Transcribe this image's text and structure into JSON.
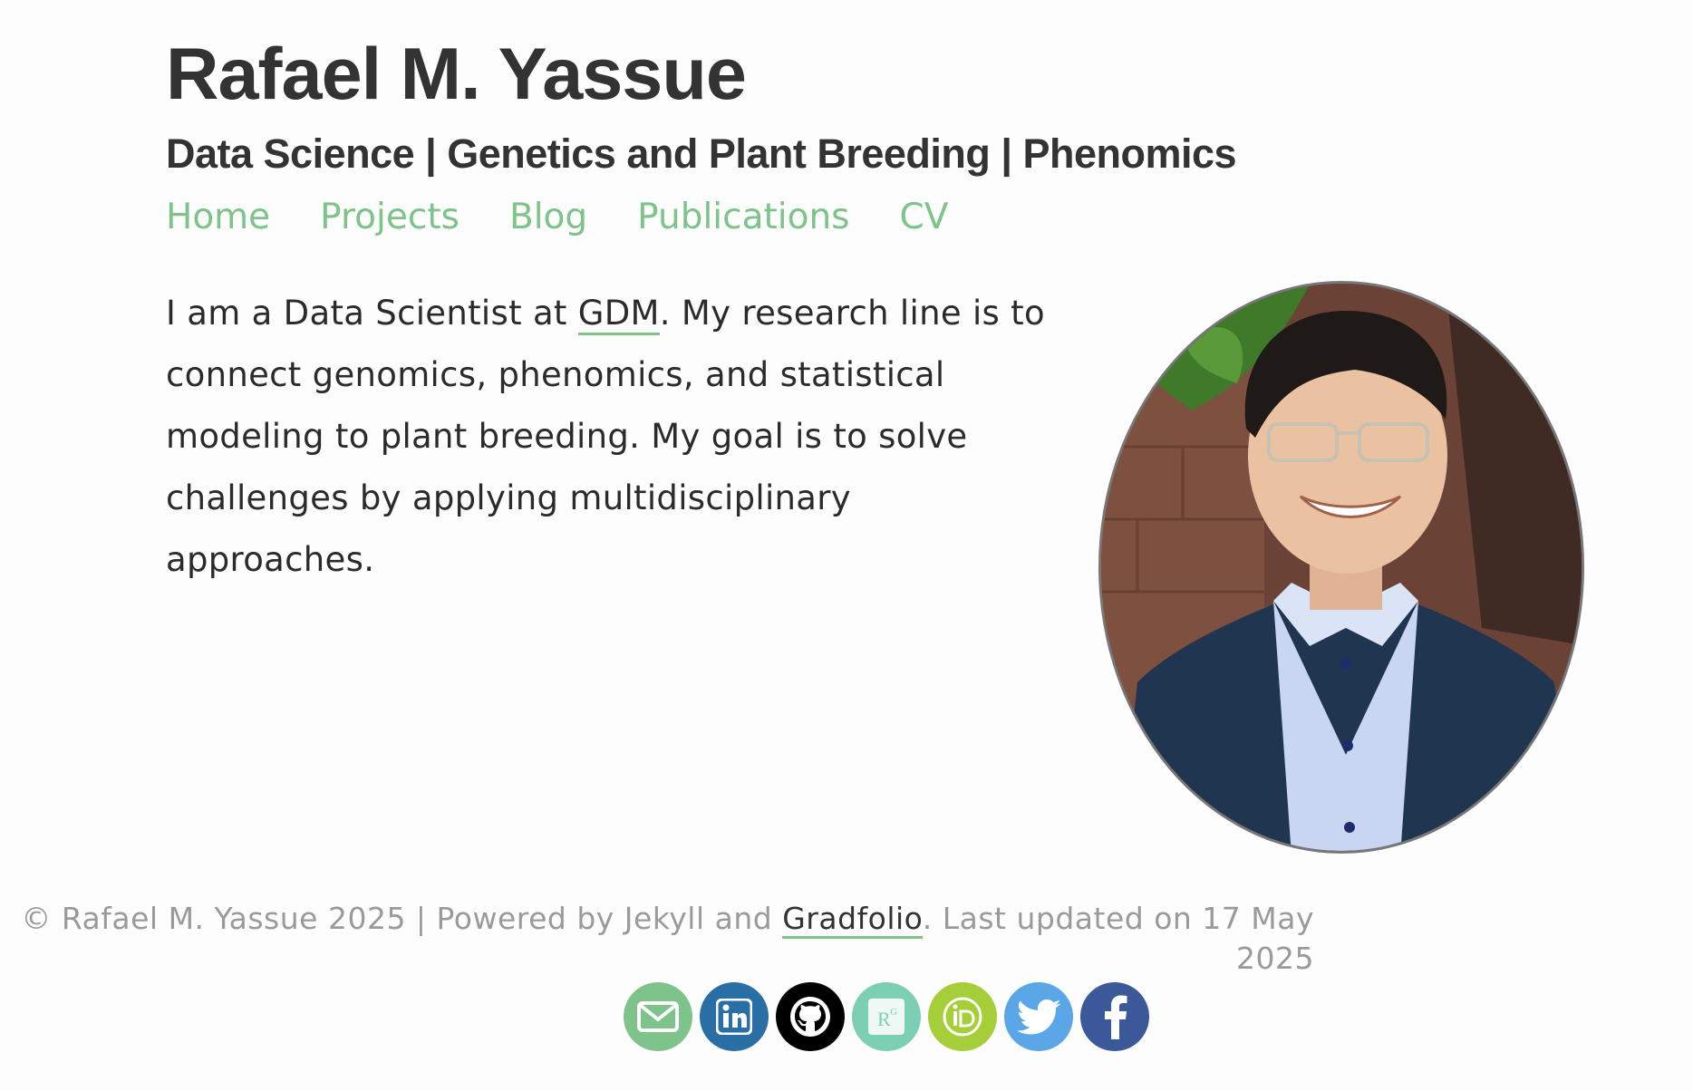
{
  "header": {
    "title": "Rafael M. Yassue",
    "subtitle": "Data Science | Genetics and Plant Breeding | Phenomics"
  },
  "nav": {
    "items": [
      {
        "label": "Home"
      },
      {
        "label": "Projects"
      },
      {
        "label": "Blog"
      },
      {
        "label": "Publications"
      },
      {
        "label": "CV"
      }
    ]
  },
  "bio": {
    "prefix": "I am a Data Scientist at ",
    "link": "GDM",
    "suffix": ". My research line is to connect genomics, phenomics, and statistical modeling to plant breeding. My goal is to solve challenges by applying multidisciplinary approaches."
  },
  "footer": {
    "prefix": "© Rafael M. Yassue 2025 | Powered by Jekyll and ",
    "link": "Gradfolio",
    "suffix": ". Last updated on 17 May 2025"
  },
  "social": [
    {
      "icon": "email-icon",
      "color": "#7dc38a"
    },
    {
      "icon": "linkedin-icon",
      "color": "#2a6ea6"
    },
    {
      "icon": "github-icon",
      "color": "#000000"
    },
    {
      "icon": "researchgate-icon",
      "color": "#7ccfb3"
    },
    {
      "icon": "orcid-icon",
      "color": "#a6ce39"
    },
    {
      "icon": "twitter-icon",
      "color": "#5aa6e6"
    },
    {
      "icon": "facebook-icon",
      "color": "#3b5998"
    }
  ],
  "colors": {
    "accent": "#7dc38a",
    "text": "#333333",
    "muted": "#9a9a9a"
  }
}
